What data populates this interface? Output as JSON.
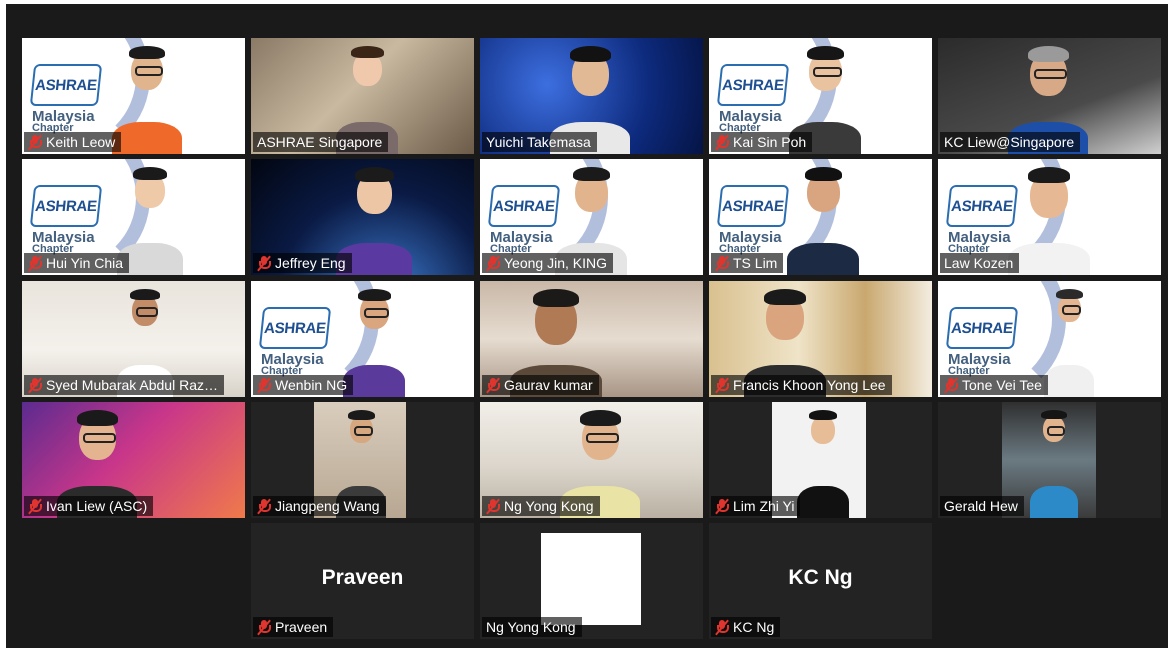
{
  "meeting": {
    "participants": [
      {
        "name": "Keith Leow",
        "muted": true,
        "background": "ashrae"
      },
      {
        "name": "ASHRAE Singapore",
        "muted": false,
        "background": "room",
        "active_speaker": true
      },
      {
        "name": "Yuichi Takemasa",
        "muted": false,
        "background": "space-blue"
      },
      {
        "name": "Kai Sin Poh",
        "muted": true,
        "background": "ashrae"
      },
      {
        "name": "KC Liew@Singapore",
        "muted": false,
        "background": "dark"
      },
      {
        "name": "Hui Yin Chia",
        "muted": true,
        "background": "ashrae"
      },
      {
        "name": "Jeffrey Eng",
        "muted": true,
        "background": "space-dark"
      },
      {
        "name": "Yeong Jin, KING",
        "muted": true,
        "background": "ashrae"
      },
      {
        "name": "TS Lim",
        "muted": true,
        "background": "ashrae"
      },
      {
        "name": "Law Kozen",
        "muted": false,
        "background": "ashrae"
      },
      {
        "name": "Syed Mubarak Abdul Raz…",
        "muted": true,
        "background": "office"
      },
      {
        "name": "Wenbin NG",
        "muted": true,
        "background": "ashrae"
      },
      {
        "name": "Gaurav kumar",
        "muted": true,
        "background": "home"
      },
      {
        "name": "Francis Khoon Yong Lee",
        "muted": true,
        "background": "curtain"
      },
      {
        "name": "Tone Vei Tee",
        "muted": true,
        "background": "ashrae"
      },
      {
        "name": "Ivan Liew (ASC)",
        "muted": true,
        "background": "gradient"
      },
      {
        "name": "Jiangpeng Wang",
        "muted": true,
        "background": "phone"
      },
      {
        "name": "Ng Yong Kong",
        "muted": true,
        "background": "living"
      },
      {
        "name": "Lim Zhi Yi",
        "muted": true,
        "background": "phone-white"
      },
      {
        "name": "Gerald Hew",
        "muted": false,
        "background": "car"
      },
      {
        "name": "Praveen",
        "muted": true,
        "background": "no-video",
        "display_text": "Praveen"
      },
      {
        "name": "Ng Yong Kong",
        "muted": false,
        "background": "white-square"
      },
      {
        "name": "KC Ng",
        "muted": true,
        "background": "no-video",
        "display_text": "KC Ng"
      }
    ]
  },
  "ashrae_logo": {
    "mark": "ASHRAE",
    "line1": "Malaysia",
    "line2": "Chapter"
  },
  "colors": {
    "stage": "#1a1a1a",
    "tile": "#232323",
    "active_border": "#cfd66a",
    "mute": "#e0342f"
  }
}
